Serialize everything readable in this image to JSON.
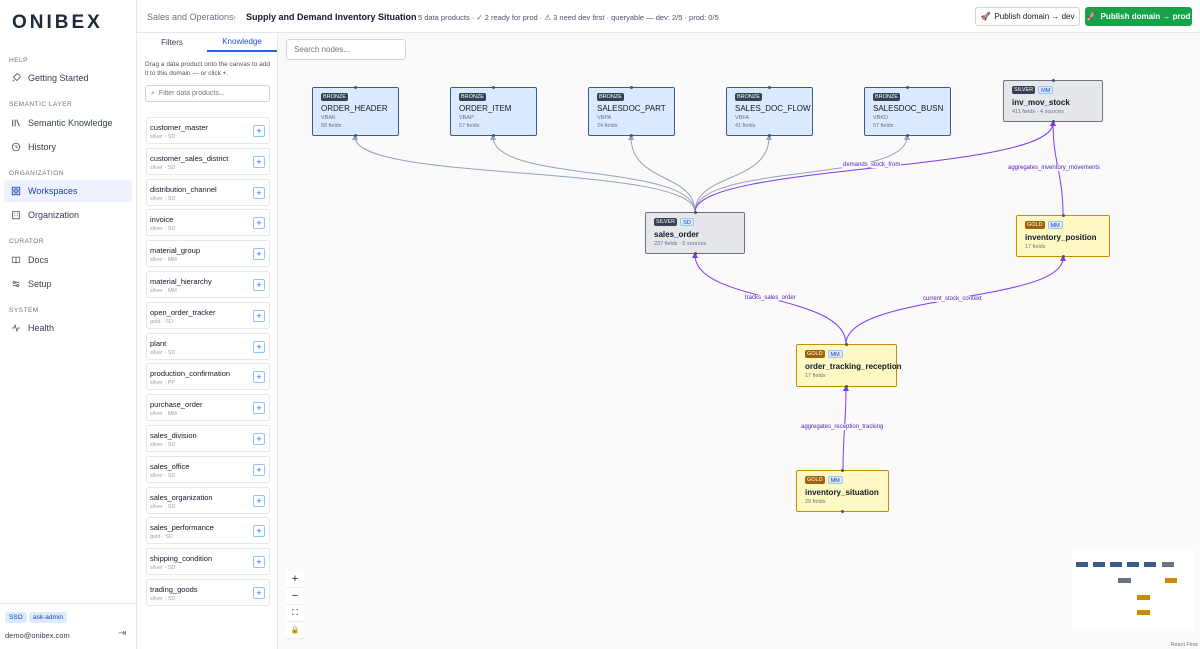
{
  "app": {
    "logo": "ONIBEX"
  },
  "sidebar": {
    "sections": [
      {
        "title": "HELP",
        "items": [
          {
            "label": "Getting Started",
            "icon": "rocket-icon"
          }
        ]
      },
      {
        "title": "SEMANTIC LAYER",
        "items": [
          {
            "label": "Semantic Knowledge",
            "icon": "library-icon"
          },
          {
            "label": "History",
            "icon": "clock-icon"
          }
        ]
      },
      {
        "title": "ORGANIZATION",
        "items": [
          {
            "label": "Workspaces",
            "icon": "grid-icon",
            "active": true
          },
          {
            "label": "Organization",
            "icon": "building-icon"
          }
        ]
      },
      {
        "title": "CURATOR",
        "items": [
          {
            "label": "Docs",
            "icon": "book-icon"
          },
          {
            "label": "Setup",
            "icon": "sliders-icon"
          }
        ]
      },
      {
        "title": "SYSTEM",
        "items": [
          {
            "label": "Health",
            "icon": "pulse-icon"
          }
        ]
      }
    ],
    "badges": [
      "SSO",
      "ask-admin"
    ],
    "user_email": "demo@onibex.com"
  },
  "header": {
    "breadcrumb_parent": "Sales and Operations",
    "breadcrumb_separator": "›",
    "breadcrumb_current": "Supply and Demand Inventory Situation",
    "status": "5 data products · ✓ 2 ready for prod · ⚠ 3 need dev first · queryable — dev: 2/5 · prod: 0/5",
    "publish_dev_label": "Publish domain → dev",
    "publish_prod_label": "Publish domain → prod"
  },
  "panel": {
    "tabs": [
      {
        "label": "Filters",
        "active": false
      },
      {
        "label": "Knowledge",
        "active": true
      }
    ],
    "hint": "Drag a data product onto the canvas to add it to this domain — or click +.",
    "filter_placeholder": "Filter data products...",
    "add_label": "+",
    "data_products": [
      {
        "name": "customer_master",
        "meta": "silver · SD"
      },
      {
        "name": "customer_sales_district",
        "meta": "silver · SD"
      },
      {
        "name": "distribution_channel",
        "meta": "silver · SD"
      },
      {
        "name": "invoice",
        "meta": "silver · SD"
      },
      {
        "name": "material_group",
        "meta": "silver · MM"
      },
      {
        "name": "material_hierarchy",
        "meta": "silver · MM"
      },
      {
        "name": "open_order_tracker",
        "meta": "gold · SD"
      },
      {
        "name": "plant",
        "meta": "silver · SD"
      },
      {
        "name": "production_confirmation",
        "meta": "silver · PP"
      },
      {
        "name": "purchase_order",
        "meta": "silver · MM"
      },
      {
        "name": "sales_division",
        "meta": "silver · SD"
      },
      {
        "name": "sales_office",
        "meta": "silver · SD"
      },
      {
        "name": "sales_organization",
        "meta": "silver · SD"
      },
      {
        "name": "sales_performance",
        "meta": "gold · SD"
      },
      {
        "name": "shipping_condition",
        "meta": "silver · SD"
      },
      {
        "name": "trading_goods",
        "meta": "silver · SD"
      }
    ]
  },
  "canvas": {
    "search_placeholder": "Search nodes...",
    "nodes": [
      {
        "id": "order_header",
        "tier": "bronze",
        "tier_label": "BRONZE",
        "name": "ORDER_HEADER",
        "sub": "VBAK",
        "fields": "58 fields"
      },
      {
        "id": "order_item",
        "tier": "bronze",
        "tier_label": "BRONZE",
        "name": "ORDER_ITEM",
        "sub": "VBAP",
        "fields": "57 fields"
      },
      {
        "id": "salesdoc_part",
        "tier": "bronze",
        "tier_label": "BRONZE",
        "name": "SALESDOC_PART",
        "sub": "VBPA",
        "fields": "24 fields"
      },
      {
        "id": "sales_doc_flow",
        "tier": "bronze",
        "tier_label": "BRONZE",
        "name": "SALES_DOC_FLOW",
        "sub": "VBFA",
        "fields": "41 fields"
      },
      {
        "id": "salesdoc_busn",
        "tier": "bronze",
        "tier_label": "BRONZE",
        "name": "SALESDOC_BUSN",
        "sub": "VBKD",
        "fields": "57 fields"
      },
      {
        "id": "inv_mov_stock",
        "tier": "silver",
        "tier_label": "SILVER",
        "domain": "MM",
        "name": "inv_mov_stock",
        "fields": "411 fields · 4 sources"
      },
      {
        "id": "sales_order",
        "tier": "silver",
        "tier_label": "SILVER",
        "domain": "SD",
        "name": "sales_order",
        "fields": "237 fields · 5 sources"
      },
      {
        "id": "inventory_position",
        "tier": "gold",
        "tier_label": "GOLD",
        "domain": "MM",
        "name": "inventory_position",
        "fields": "17 fields"
      },
      {
        "id": "order_tracking_reception",
        "tier": "gold",
        "tier_label": "GOLD",
        "domain": "MM",
        "name": "order_tracking_reception",
        "fields": "17 fields"
      },
      {
        "id": "inventory_situation",
        "tier": "gold",
        "tier_label": "GOLD",
        "domain": "MM",
        "name": "inventory_situation",
        "fields": "29 fields"
      }
    ],
    "edge_labels": [
      {
        "id": "demands",
        "label": "demands_stock_from"
      },
      {
        "id": "aggregates_inv",
        "label": "aggregates_inventory_movements"
      },
      {
        "id": "tracks",
        "label": "tracks_sales_order"
      },
      {
        "id": "current_stock",
        "label": "current_stock_context"
      },
      {
        "id": "aggregates_rec",
        "label": "aggregates_reception_tracking"
      }
    ],
    "controls": [
      "+",
      "−",
      "⛶",
      "🔒"
    ],
    "attribution": "React Flow",
    "colors": {
      "lineage_edge": "#94a3b8",
      "relation_edge": "#7c3aed",
      "bronze": "#3b5b8f",
      "silver": "#6b7280",
      "gold": "#ca8a04"
    }
  }
}
